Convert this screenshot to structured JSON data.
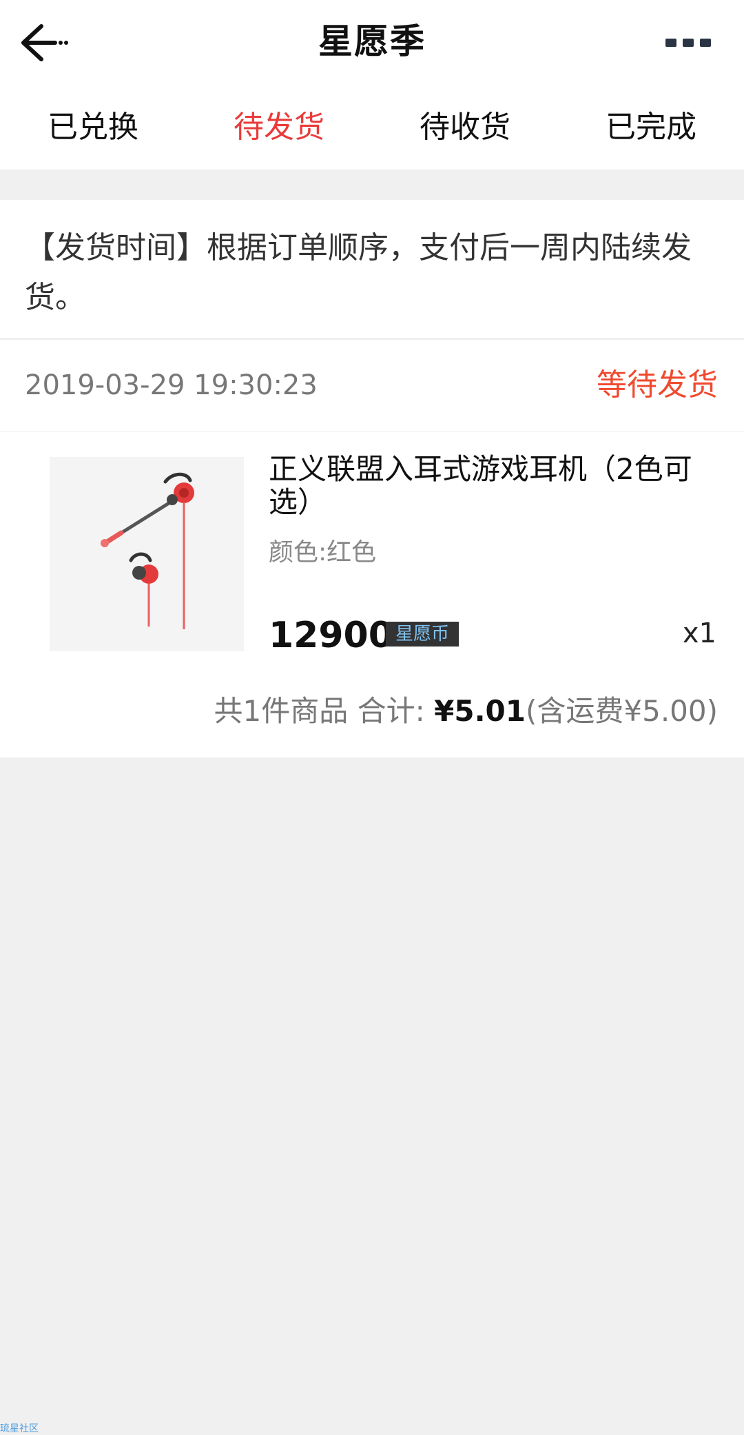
{
  "header": {
    "title": "星愿季",
    "back_icon": "back-arrow-icon",
    "more_icon": "more-icon"
  },
  "tabs": [
    {
      "label": "已兑换",
      "active": false
    },
    {
      "label": "待发货",
      "active": true
    },
    {
      "label": "待收货",
      "active": false
    },
    {
      "label": "已完成",
      "active": false
    }
  ],
  "notice": {
    "text": "【发货时间】根据订单顺序，支付后一周内陆续发货。"
  },
  "order": {
    "time": "2019-03-29 19:30:23",
    "status": "等待发货",
    "product": {
      "name": "正义联盟入耳式游戏耳机（2色可选）",
      "spec": "颜色:红色",
      "price": "12900",
      "currency_tag": "星愿币",
      "quantity": "x1"
    },
    "summary": {
      "count_text": "共1件商品 合计: ",
      "total": "¥5.01",
      "shipping": "(含运费¥5.00)"
    }
  },
  "footer_watermark": "琉星社区",
  "colors": {
    "accent": "#e93b3b",
    "status": "#f04a2f",
    "background": "#f0f0f0"
  }
}
